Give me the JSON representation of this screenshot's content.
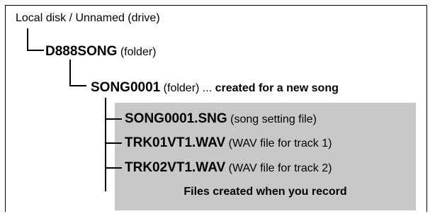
{
  "tree": {
    "root": {
      "label": "Local disk / Unnamed (drive)"
    },
    "song_folder_root": {
      "name": "D888SONG",
      "desc": " (folder)"
    },
    "song_folder": {
      "name": "SONG0001",
      "desc": " (folder) ... ",
      "note": "created for a new song"
    },
    "files": [
      {
        "name": "SONG0001.SNG",
        "desc": " (song setting file)"
      },
      {
        "name": "TRK01VT1.WAV",
        "desc": " (WAV file for track 1)"
      },
      {
        "name": "TRK02VT1.WAV",
        "desc": " (WAV file for track 2)"
      }
    ],
    "caption": "Files created when you record"
  },
  "colors": {
    "highlight_box": "#c8c8c8",
    "lines": "#000000"
  }
}
